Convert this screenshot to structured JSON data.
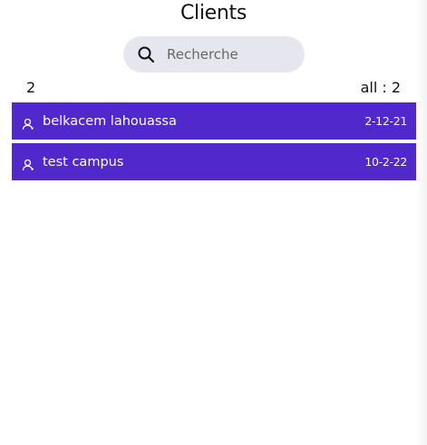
{
  "header": {
    "title": "Clients"
  },
  "search": {
    "placeholder": "Recherche",
    "value": "",
    "icon": "search-icon"
  },
  "summary": {
    "count": "2",
    "all_label": "all : 2"
  },
  "clients": [
    {
      "name": "belkacem lahouassa",
      "date": "2-12-21",
      "icon": "user-icon"
    },
    {
      "name": "test campus",
      "date": "10-2-22",
      "icon": "user-icon"
    }
  ],
  "colors": {
    "row_background": "#5128cc",
    "search_background": "#e6e7ee",
    "text_on_row": "#ffffff"
  }
}
